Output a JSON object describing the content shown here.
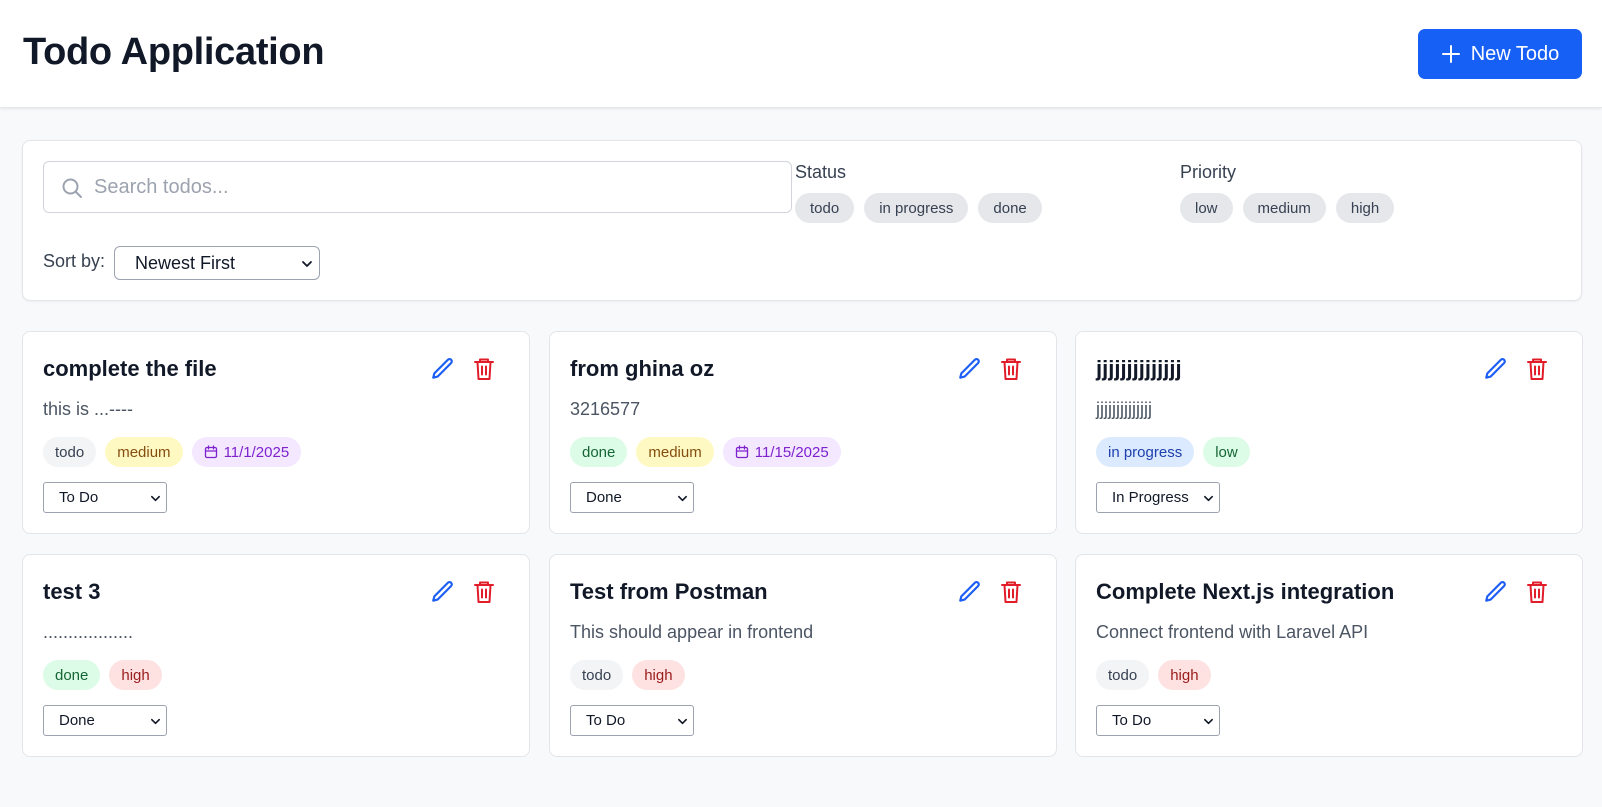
{
  "header": {
    "title": "Todo Application",
    "new_button_label": "New Todo"
  },
  "search": {
    "placeholder": "Search todos...",
    "value": ""
  },
  "filters": {
    "status": {
      "label": "Status",
      "options": [
        "todo",
        "in progress",
        "done"
      ]
    },
    "priority": {
      "label": "Priority",
      "options": [
        "low",
        "medium",
        "high"
      ]
    }
  },
  "sort": {
    "label": "Sort by:",
    "value": "Newest First"
  },
  "tag_colors": {
    "todo": {
      "bg": "#f3f4f6",
      "fg": "#374151"
    },
    "in progress": {
      "bg": "#dbeafe",
      "fg": "#1e40af"
    },
    "done": {
      "bg": "#dcfce7",
      "fg": "#166534"
    },
    "low": {
      "bg": "#dcfce7",
      "fg": "#166534"
    },
    "medium": {
      "bg": "#fef9c3",
      "fg": "#854d0e"
    },
    "high": {
      "bg": "#fee2e2",
      "fg": "#991b1b"
    },
    "date": {
      "bg": "#f3e8ff",
      "fg": "#7e22ce"
    }
  },
  "icon_colors": {
    "edit": "#1d5ef5",
    "delete": "#e11d2a"
  },
  "todos": [
    {
      "title": "complete the file",
      "description": "this is ...----",
      "status": "todo",
      "priority": "medium",
      "due_date": "11/1/2025",
      "status_select": "To Do"
    },
    {
      "title": "from ghina oz",
      "description": "3216577",
      "status": "done",
      "priority": "medium",
      "due_date": "11/15/2025",
      "status_select": "Done"
    },
    {
      "title": "jjjjjjjjjjjjjj",
      "description": "jjjjjjjjjjjjjj",
      "status": "in progress",
      "priority": "low",
      "due_date": "",
      "status_select": "In Progress"
    },
    {
      "title": "test 3",
      "description": "..................",
      "status": "done",
      "priority": "high",
      "due_date": "",
      "status_select": "Done"
    },
    {
      "title": "Test from Postman",
      "description": "This should appear in frontend",
      "status": "todo",
      "priority": "high",
      "due_date": "",
      "status_select": "To Do"
    },
    {
      "title": "Complete Next.js integration",
      "description": "Connect frontend with Laravel API",
      "status": "todo",
      "priority": "high",
      "due_date": "",
      "status_select": "To Do"
    }
  ]
}
